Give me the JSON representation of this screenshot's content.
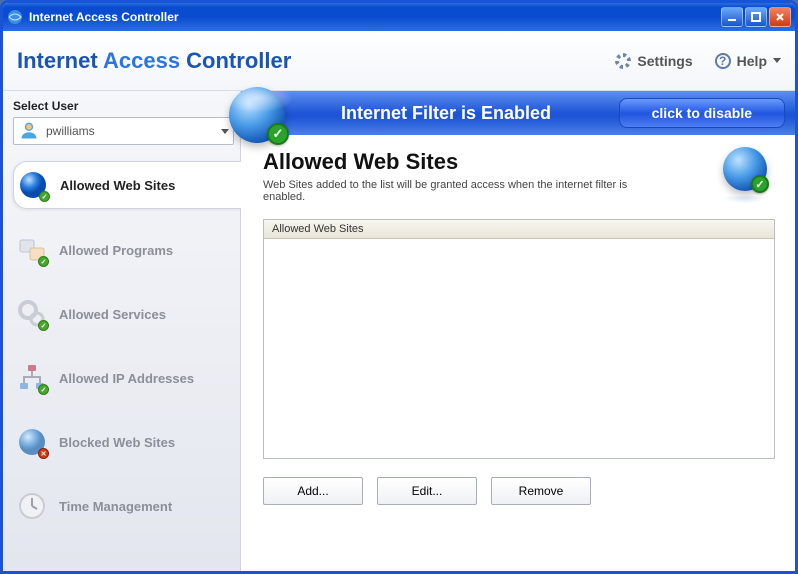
{
  "window": {
    "title": "Internet Access Controller"
  },
  "header": {
    "title_part1": "Internet ",
    "title_part2": "Access ",
    "title_part3": "Controller",
    "settings_label": "Settings",
    "help_label": "Help"
  },
  "sidebar": {
    "select_user_label": "Select User",
    "selected_user": "pwilliams",
    "items": [
      {
        "label": "Allowed Web Sites"
      },
      {
        "label": "Allowed Programs"
      },
      {
        "label": "Allowed Services"
      },
      {
        "label": "Allowed IP Addresses"
      },
      {
        "label": "Blocked Web Sites"
      },
      {
        "label": "Time Management"
      }
    ]
  },
  "status": {
    "text": "Internet Filter is Enabled",
    "disable_label": "click to disable"
  },
  "content": {
    "title": "Allowed Web Sites",
    "description": "Web Sites added to the list will be granted access when the internet filter is enabled.",
    "list_header": "Allowed Web Sites",
    "buttons": {
      "add": "Add...",
      "edit": "Edit...",
      "remove": "Remove"
    }
  }
}
